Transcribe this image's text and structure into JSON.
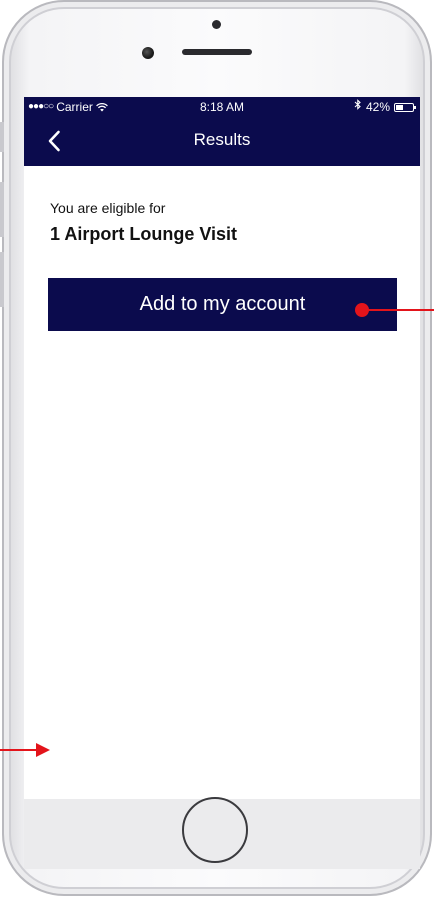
{
  "status_bar": {
    "signal": "●●●○○",
    "carrier": "Carrier",
    "time": "8:18 AM",
    "battery_percent": "42%",
    "battery_level": 0.42
  },
  "nav": {
    "title": "Results"
  },
  "content": {
    "eligible_label": "You are eligible for",
    "eligible_value": "1 Airport Lounge Visit",
    "add_button_label": "Add to my account"
  },
  "colors": {
    "navbar": "#0b0b4d",
    "button": "#0b0b4d",
    "annotation": "#e3141b"
  },
  "icons": {
    "back": "chevron-left-icon",
    "wifi": "wifi-icon",
    "bluetooth": "bluetooth-icon",
    "battery": "battery-icon"
  }
}
